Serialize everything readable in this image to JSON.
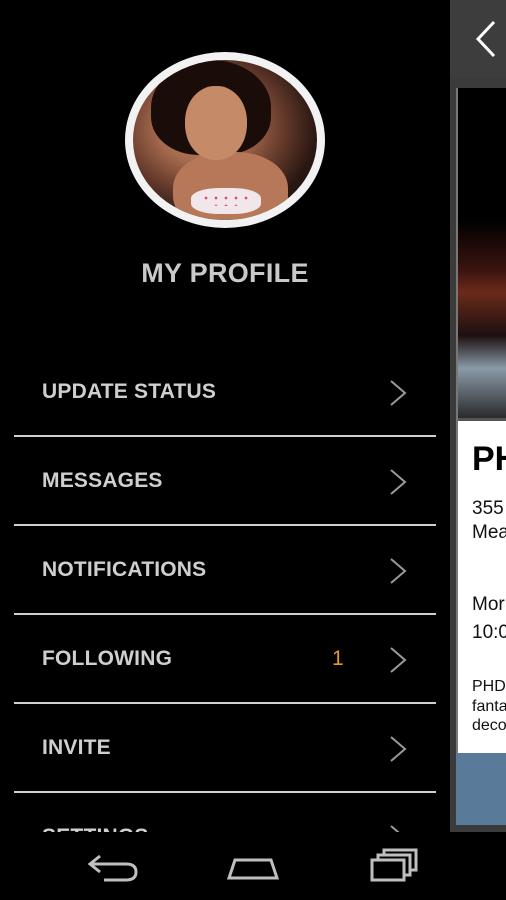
{
  "profile": {
    "title": "MY PROFILE"
  },
  "menu": {
    "items": [
      {
        "label": "UPDATE STATUS",
        "count": ""
      },
      {
        "label": "MESSAGES",
        "count": ""
      },
      {
        "label": "NOTIFICATIONS",
        "count": ""
      },
      {
        "label": "FOLLOWING",
        "count": "1"
      },
      {
        "label": "INVITE",
        "count": ""
      },
      {
        "label": "SETTINGS",
        "count": ""
      }
    ]
  },
  "detail_panel": {
    "title": "PH",
    "address_line1": "355",
    "address_line2": "Mea",
    "hours_line1": "Mor",
    "hours_line2": "10:0",
    "desc_line1": "PHD",
    "desc_line2": "fanta",
    "desc_line3": "deco"
  },
  "colors": {
    "accent": "#e89a1a",
    "menu_text": "#cfcfcf",
    "divider": "#d0d0d0",
    "button": "#5a7a99"
  },
  "icons": {
    "back": "chevron-left-icon",
    "item": "chevron-right-icon",
    "nav_back": "back-icon",
    "nav_home": "home-icon",
    "nav_recents": "recents-icon"
  }
}
